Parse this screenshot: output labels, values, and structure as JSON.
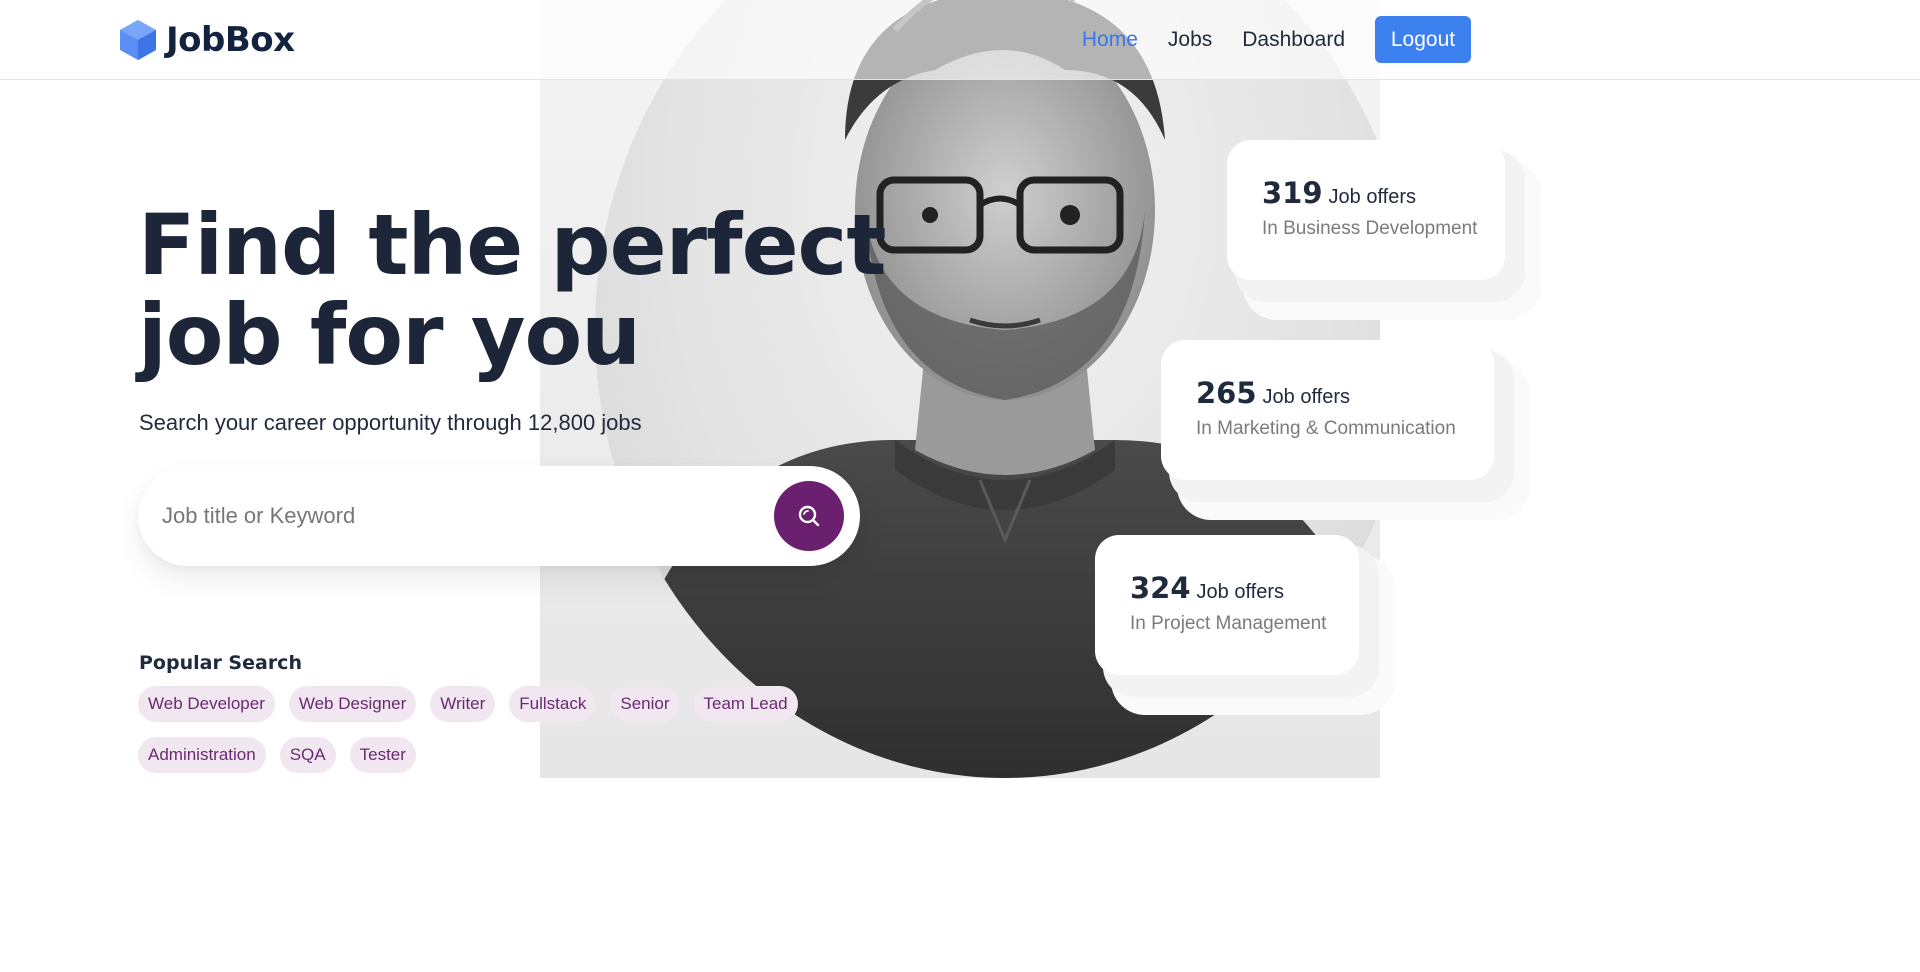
{
  "header": {
    "logo_text": "JobBox",
    "nav": [
      {
        "label": "Home",
        "active": true
      },
      {
        "label": "Jobs",
        "active": false
      },
      {
        "label": "Dashboard",
        "active": false
      }
    ],
    "logout_label": "Logout"
  },
  "hero": {
    "title_line1": "Find the perfect",
    "title_line2": "job for you",
    "subtitle": "Search your career opportunity through 12,800 jobs",
    "search_placeholder": "Job title or Keyword",
    "search_icon": "search-icon"
  },
  "popular": {
    "label": "Popular Search",
    "tags_row1": [
      "Web Developer",
      "Web Designer",
      "Writer",
      "Fullstack",
      "Senior",
      "Team Lead"
    ],
    "tags_row2": [
      "Administration",
      "SQA",
      "Tester"
    ]
  },
  "stats": [
    {
      "count": "319",
      "label": "Job offers",
      "category": "In Business Development"
    },
    {
      "count": "265",
      "label": "Job offers",
      "category": "In Marketing & Communication"
    },
    {
      "count": "324",
      "label": "Job offers",
      "category": "In Project Management"
    }
  ],
  "colors": {
    "primary": "#3d81f0",
    "accent_purple": "#6b1f6f",
    "tag_bg": "#f0e7f1",
    "heading": "#1d2638"
  }
}
